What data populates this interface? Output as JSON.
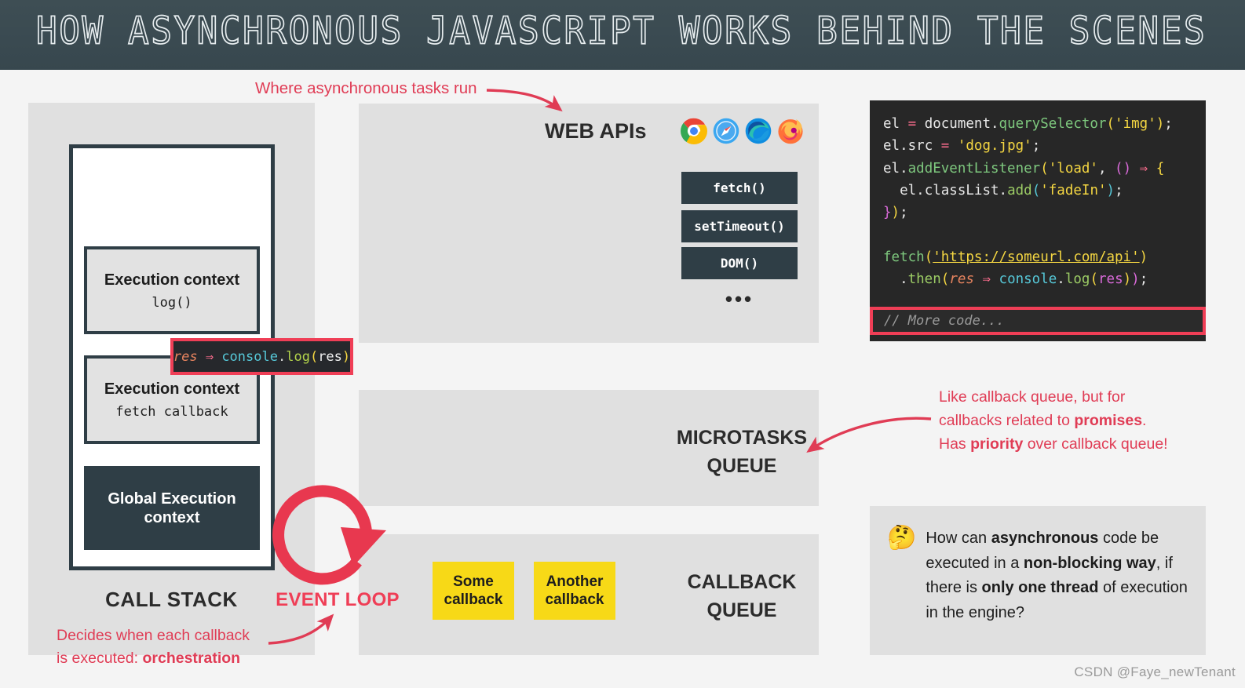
{
  "header": {
    "title": "HOW ASYNCHRONOUS JAVASCRIPT WORKS BEHIND THE SCENES",
    "background_color": "#37474e"
  },
  "annotations": {
    "where_async": "Where asynchronous tasks run",
    "decides_line1": "Decides when each callback",
    "decides_line2_prefix": "is executed: ",
    "decides_line2_bold": "orchestration",
    "accent_color": "#e03c55"
  },
  "call_stack": {
    "label": "CALL STACK",
    "contexts": [
      {
        "title": "Execution context",
        "sub": "log()"
      },
      {
        "title": "Execution context",
        "sub": "fetch callback"
      }
    ],
    "global": "Global Execution context",
    "tooltip": {
      "res": "res",
      "arrow": "⇒",
      "console": "console",
      "dot": ".",
      "log": "log",
      "open_paren": "(",
      "inner": "res",
      "close_paren": ")"
    }
  },
  "web_apis": {
    "title": "WEB APIs",
    "browsers": [
      "chrome-icon",
      "safari-icon",
      "edge-icon",
      "firefox-icon"
    ],
    "buttons": [
      "fetch()",
      "setTimeout()",
      "DOM()"
    ],
    "ellipsis": "•••"
  },
  "microtasks_queue": {
    "line1": "MICROTASKS",
    "line2": "QUEUE",
    "note_line1": "Like callback queue, but for",
    "note_line2_prefix": "callbacks related to ",
    "note_line2_bold": "promises",
    "note_line2_suffix": ".",
    "note_line3_prefix": "Has ",
    "note_line3_bold": "priority",
    "note_line3_suffix": " over callback queue!"
  },
  "callback_queue": {
    "line1": "CALLBACK",
    "line2": "QUEUE",
    "cards": [
      "Some callback",
      "Another callback"
    ],
    "card_color": "#f7d917"
  },
  "event_loop": {
    "label": "EVENT LOOP",
    "icon": "circular-arrow-icon"
  },
  "code_panel": {
    "lines": [
      {
        "tokens": [
          {
            "t": "el ",
            "c": "c-plain"
          },
          {
            "t": "= ",
            "c": "c-op"
          },
          {
            "t": "document",
            "c": "c-plain"
          },
          {
            "t": ".",
            "c": "c-plain"
          },
          {
            "t": "querySelector",
            "c": "c-prop"
          },
          {
            "t": "(",
            "c": "c-paren"
          },
          {
            "t": "'img'",
            "c": "c-str"
          },
          {
            "t": ")",
            "c": "c-paren"
          },
          {
            "t": ";",
            "c": "c-plain"
          }
        ]
      },
      {
        "tokens": [
          {
            "t": "el",
            "c": "c-plain"
          },
          {
            "t": ".",
            "c": "c-plain"
          },
          {
            "t": "src ",
            "c": "c-plain"
          },
          {
            "t": "= ",
            "c": "c-op"
          },
          {
            "t": "'dog.jpg'",
            "c": "c-str"
          },
          {
            "t": ";",
            "c": "c-plain"
          }
        ]
      },
      {
        "tokens": [
          {
            "t": "el",
            "c": "c-plain"
          },
          {
            "t": ".",
            "c": "c-plain"
          },
          {
            "t": "addEventListener",
            "c": "c-prop"
          },
          {
            "t": "(",
            "c": "c-paren"
          },
          {
            "t": "'load'",
            "c": "c-str"
          },
          {
            "t": ", ",
            "c": "c-plain"
          },
          {
            "t": "()",
            "c": "c-paren2"
          },
          {
            "t": " ⇒ ",
            "c": "c-op"
          },
          {
            "t": "{",
            "c": "c-str"
          }
        ]
      },
      {
        "tokens": [
          {
            "t": "  el",
            "c": "c-plain"
          },
          {
            "t": ".",
            "c": "c-plain"
          },
          {
            "t": "classList",
            "c": "c-plain"
          },
          {
            "t": ".",
            "c": "c-plain"
          },
          {
            "t": "add",
            "c": "c-green"
          },
          {
            "t": "(",
            "c": "c-cyan"
          },
          {
            "t": "'fadeIn'",
            "c": "c-str"
          },
          {
            "t": ")",
            "c": "c-cyan"
          },
          {
            "t": ";",
            "c": "c-plain"
          }
        ]
      },
      {
        "tokens": [
          {
            "t": "}",
            "c": "c-paren2"
          },
          {
            "t": ")",
            "c": "c-str"
          },
          {
            "t": ";",
            "c": "c-plain"
          }
        ]
      },
      {
        "tokens": []
      },
      {
        "tokens": [
          {
            "t": "fetch",
            "c": "c-prop"
          },
          {
            "t": "(",
            "c": "c-str"
          },
          {
            "t": "'https://someurl.com/api'",
            "c": "c-url"
          },
          {
            "t": ")",
            "c": "c-str"
          }
        ]
      },
      {
        "tokens": [
          {
            "t": "  .",
            "c": "c-plain"
          },
          {
            "t": "then",
            "c": "c-green"
          },
          {
            "t": "(",
            "c": "c-str"
          },
          {
            "t": "res",
            "c": "c-res"
          },
          {
            "t": " ⇒ ",
            "c": "c-pink"
          },
          {
            "t": "console",
            "c": "c-cyan"
          },
          {
            "t": ".",
            "c": "c-plain"
          },
          {
            "t": "log",
            "c": "c-green"
          },
          {
            "t": "(",
            "c": "c-str"
          },
          {
            "t": "res",
            "c": "c-paren2"
          },
          {
            "t": ")",
            "c": "c-str"
          },
          {
            "t": ")",
            "c": "c-paren2"
          },
          {
            "t": ";",
            "c": "c-plain"
          }
        ]
      }
    ],
    "more_code": "// More code...",
    "highlight_color": "#ef3e56"
  },
  "question_box": {
    "emoji": "🤔",
    "segments": [
      {
        "text": "How can ",
        "bold": false
      },
      {
        "text": "asynchronous",
        "bold": true
      },
      {
        "text": " code be executed in a ",
        "bold": false
      },
      {
        "text": "non-blocking way",
        "bold": true
      },
      {
        "text": ", if there is ",
        "bold": false
      },
      {
        "text": "only one thread",
        "bold": true
      },
      {
        "text": " of execution in the engine?",
        "bold": false
      }
    ]
  },
  "watermark": "CSDN @Faye_newTenant"
}
